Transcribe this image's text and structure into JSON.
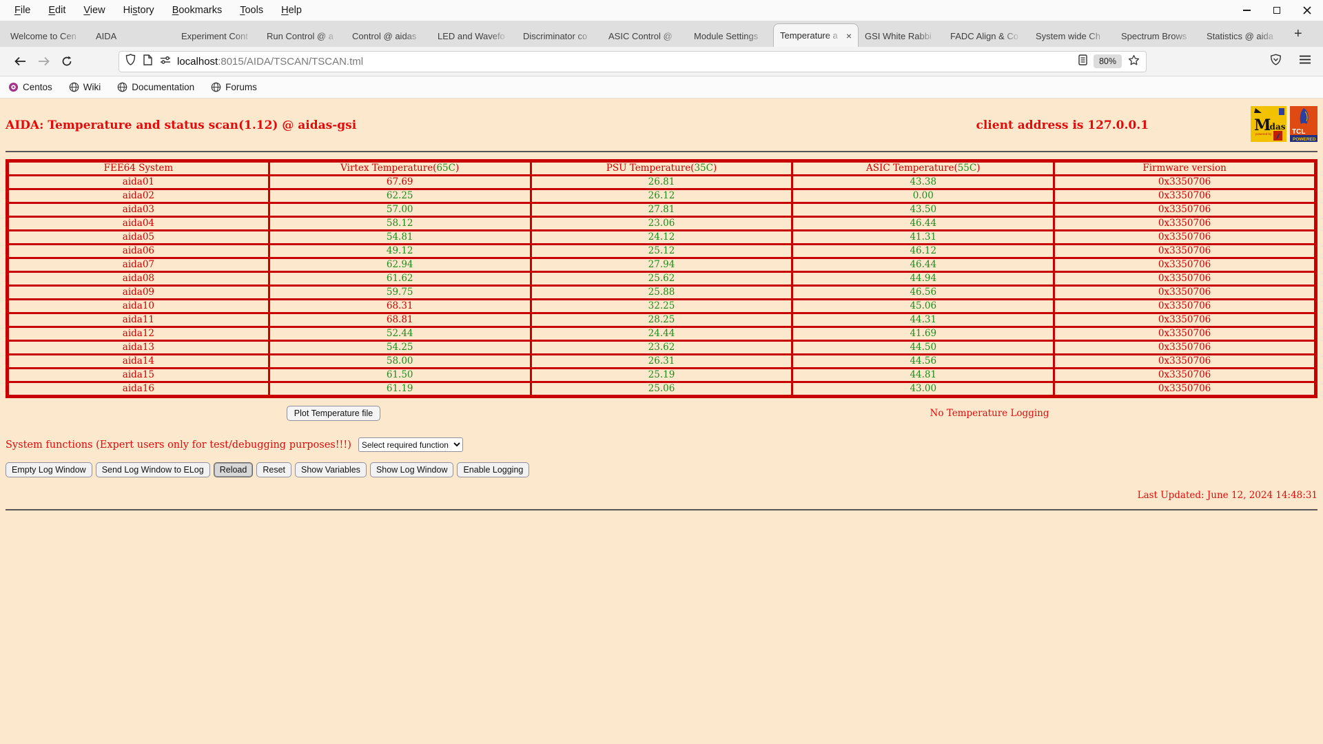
{
  "menubar": {
    "items": [
      {
        "label": "File",
        "mnemonic": 0
      },
      {
        "label": "Edit",
        "mnemonic": 0
      },
      {
        "label": "View",
        "mnemonic": 0
      },
      {
        "label": "History",
        "mnemonic": 2
      },
      {
        "label": "Bookmarks",
        "mnemonic": 0
      },
      {
        "label": "Tools",
        "mnemonic": 0
      },
      {
        "label": "Help",
        "mnemonic": 0
      }
    ]
  },
  "tabs": {
    "close_glyph": "×",
    "new_tab_glyph": "+",
    "items": [
      {
        "label": "Welcome to Cen"
      },
      {
        "label": "AIDA"
      },
      {
        "label": "Experiment Cont"
      },
      {
        "label": "Run Control @ a"
      },
      {
        "label": "Control @ aidas"
      },
      {
        "label": "LED and Wavefo"
      },
      {
        "label": "Discriminator co"
      },
      {
        "label": "ASIC Control @"
      },
      {
        "label": "Module Settings"
      },
      {
        "label": "Temperature a",
        "active": true
      },
      {
        "label": "GSI White Rabbi"
      },
      {
        "label": "FADC Align & Co"
      },
      {
        "label": "System wide Ch"
      },
      {
        "label": "Spectrum Brows"
      },
      {
        "label": "Statistics @ aida"
      }
    ]
  },
  "navbar": {
    "url_host": "localhost",
    "url_path": ":8015/AIDA/TSCAN/TSCAN.tml",
    "zoom_level": "80%"
  },
  "bookmarks": {
    "items": [
      {
        "label": "Centos",
        "icon": "centos-icon"
      },
      {
        "label": "Wiki",
        "icon": "globe-icon"
      },
      {
        "label": "Documentation",
        "icon": "globe-icon"
      },
      {
        "label": "Forums",
        "icon": "globe-icon"
      }
    ]
  },
  "page": {
    "title": "AIDA: Temperature and status scan(1.12) @ aidas-gsi",
    "client_address": "client address is 127.0.0.1",
    "logos": {
      "midas_text": "Midas",
      "midas_sub": "powered by",
      "tcl_text": "TCL",
      "tcl_sub": "POWERED"
    },
    "table": {
      "headers": [
        {
          "text": "FEE64 System"
        },
        {
          "pre": "Virtex Temperature(",
          "limit": "65C",
          "post": ")"
        },
        {
          "pre": "PSU Temperature(",
          "limit": "35C",
          "post": ")"
        },
        {
          "pre": "ASIC Temperature(",
          "limit": "55C",
          "post": ")"
        },
        {
          "text": "Firmware version"
        }
      ],
      "rows": [
        {
          "system": "aida01",
          "virtex": "67.69",
          "virtex_alarm": true,
          "psu": "26.81",
          "asic": "43.38",
          "fw": "0x3350706"
        },
        {
          "system": "aida02",
          "virtex": "62.25",
          "virtex_alarm": false,
          "psu": "26.12",
          "asic": "0.00",
          "fw": "0x3350706"
        },
        {
          "system": "aida03",
          "virtex": "57.00",
          "virtex_alarm": false,
          "psu": "27.81",
          "asic": "43.50",
          "fw": "0x3350706"
        },
        {
          "system": "aida04",
          "virtex": "58.12",
          "virtex_alarm": false,
          "psu": "23.06",
          "asic": "46.44",
          "fw": "0x3350706"
        },
        {
          "system": "aida05",
          "virtex": "54.81",
          "virtex_alarm": false,
          "psu": "24.12",
          "asic": "41.31",
          "fw": "0x3350706"
        },
        {
          "system": "aida06",
          "virtex": "49.12",
          "virtex_alarm": false,
          "psu": "25.12",
          "asic": "46.12",
          "fw": "0x3350706"
        },
        {
          "system": "aida07",
          "virtex": "62.94",
          "virtex_alarm": false,
          "psu": "27.94",
          "asic": "46.44",
          "fw": "0x3350706"
        },
        {
          "system": "aida08",
          "virtex": "61.62",
          "virtex_alarm": false,
          "psu": "25.62",
          "asic": "44.94",
          "fw": "0x3350706"
        },
        {
          "system": "aida09",
          "virtex": "59.75",
          "virtex_alarm": false,
          "psu": "25.88",
          "asic": "46.56",
          "fw": "0x3350706"
        },
        {
          "system": "aida10",
          "virtex": "68.31",
          "virtex_alarm": true,
          "psu": "32.25",
          "asic": "45.06",
          "fw": "0x3350706"
        },
        {
          "system": "aida11",
          "virtex": "68.81",
          "virtex_alarm": true,
          "psu": "28.25",
          "asic": "44.31",
          "fw": "0x3350706"
        },
        {
          "system": "aida12",
          "virtex": "52.44",
          "virtex_alarm": false,
          "psu": "24.44",
          "asic": "41.69",
          "fw": "0x3350706"
        },
        {
          "system": "aida13",
          "virtex": "54.25",
          "virtex_alarm": false,
          "psu": "23.62",
          "asic": "44.50",
          "fw": "0x3350706"
        },
        {
          "system": "aida14",
          "virtex": "58.00",
          "virtex_alarm": false,
          "psu": "26.31",
          "asic": "44.56",
          "fw": "0x3350706"
        },
        {
          "system": "aida15",
          "virtex": "61.50",
          "virtex_alarm": false,
          "psu": "25.19",
          "asic": "44.81",
          "fw": "0x3350706"
        },
        {
          "system": "aida16",
          "virtex": "61.19",
          "virtex_alarm": false,
          "psu": "25.06",
          "asic": "43.00",
          "fw": "0x3350706"
        }
      ]
    },
    "plot_button": "Plot Temperature file",
    "logging_status": "No Temperature Logging",
    "system_functions_label": "System functions (Expert users only for test/debugging purposes!!!)",
    "function_select_value": "Select required function",
    "action_buttons": [
      {
        "label": "Empty Log Window"
      },
      {
        "label": "Send Log Window to ELog"
      },
      {
        "label": "Reload",
        "pressed": true
      },
      {
        "label": "Reset"
      },
      {
        "label": "Show Variables"
      },
      {
        "label": "Show Log Window"
      },
      {
        "label": "Enable Logging"
      }
    ],
    "last_updated": "Last Updated: June 12, 2024 14:48:31"
  },
  "colors": {
    "page_background": "#FCE9CD",
    "text_red": "#CC0000",
    "title_red": "#E20A0A",
    "ok_green": "#1E8B1E",
    "table_border_red": "#C80000"
  }
}
